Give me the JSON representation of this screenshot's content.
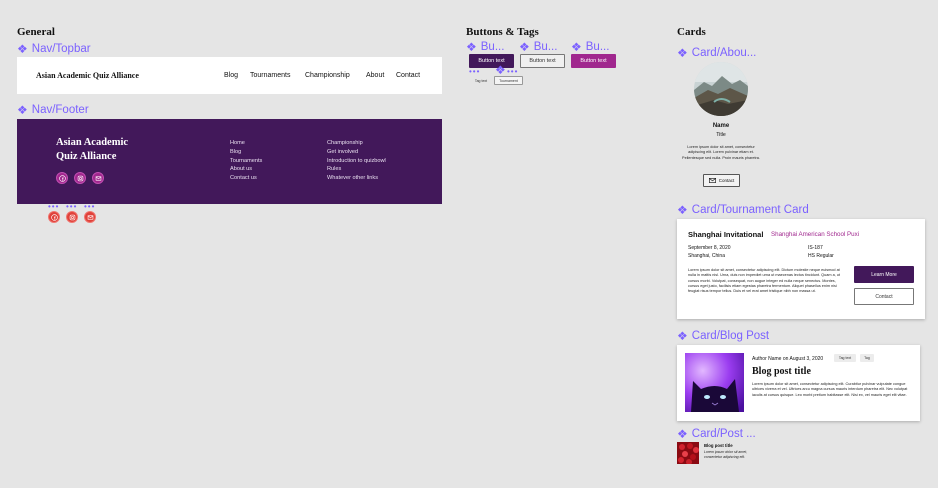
{
  "sections": {
    "general": "General",
    "buttons": "Buttons & Tags",
    "cards": "Cards"
  },
  "components": {
    "topbar": "Nav/Topbar",
    "footer": "Nav/Footer",
    "button1": "Bu...",
    "button2": "Bu...",
    "button3": "Bu...",
    "card_about": "Card/Abou...",
    "card_tournament": "Card/Tournament Card",
    "card_blog": "Card/Blog Post",
    "card_post": "Card/Post ..."
  },
  "topbar": {
    "brand": "Asian Academic Quiz Alliance",
    "nav": [
      "Blog",
      "Tournaments",
      "Championship",
      "About",
      "Contact"
    ]
  },
  "footer": {
    "brand_line1": "Asian Academic",
    "brand_line2": "Quiz Alliance",
    "col1": [
      "Home",
      "Blog",
      "Tournaments",
      "About us",
      "Contact us"
    ],
    "col2": [
      "Championship",
      "Get involved",
      "Introduction to quizbowl",
      "Rules",
      "Whatever other links"
    ]
  },
  "buttons": {
    "primary": "Button text",
    "outline": "Button text",
    "accent": "Button text",
    "tag1": "Tag text",
    "tag2": "Tournament"
  },
  "about_card": {
    "name": "Name",
    "title": "Title",
    "bio": "Lorem ipsum dolor sit amet, consectetur adipiscing elit. Lorem pulvinar etiam et. Pellentesque sed nulla. Proin mauris pharetra.",
    "contact": "Contact"
  },
  "tournament_card": {
    "name": "Shanghai Invitational",
    "host": "Shanghai American School Puxi",
    "date": "September 8, 2020",
    "location": "Shanghai, China",
    "set": "IS-187",
    "level": "HS Regular",
    "description": "Lorem ipsum dolor sit amet, consectetur adipiscing elit. Dictum molestie neque euismod at nulla in mattis nisl. Urna, duis non imperdiet urna ut maecenas lectus tincidunt. Quam a, ut cursus morbi. Volutpat, consequat, non augue integer ed nulla neque senectus. Montes, cursus eget justo, facilisis etiam egestas pharetra fermentum. Aliquet phasellus enim nisi feugiat risus tempor tellus. Duis et vel erat amet tristique nibh non massa ut.",
    "learn_more": "Learn More",
    "contact": "Contact"
  },
  "blog_card": {
    "author": "Author Name on August 3, 2020",
    "tag1": "Tag text",
    "tag2": "Tag",
    "title": "Blog post title",
    "excerpt": "Lorem ipsum dolor sit amet, consectetur adipiscing elit. Curabitur pulvinar vulputate congue ultrices viverra et vel. Ultrices arcu magna cursus mauris interdum pharetra elit. Nec volutpat iaculis at cursus quisque. Leo morbi pretium habitasse elit. Nisi ex, vel mauris eget elit vitae."
  },
  "post_card": {
    "title": "Blog post title",
    "excerpt": "Lorem ipsum dolor sit amet, consectetur adipiscing elit."
  },
  "colors": {
    "purple_dark": "#42185a",
    "accent": "#a0278e",
    "social_red": "#e0413a",
    "component_label": "#7b61ff"
  }
}
